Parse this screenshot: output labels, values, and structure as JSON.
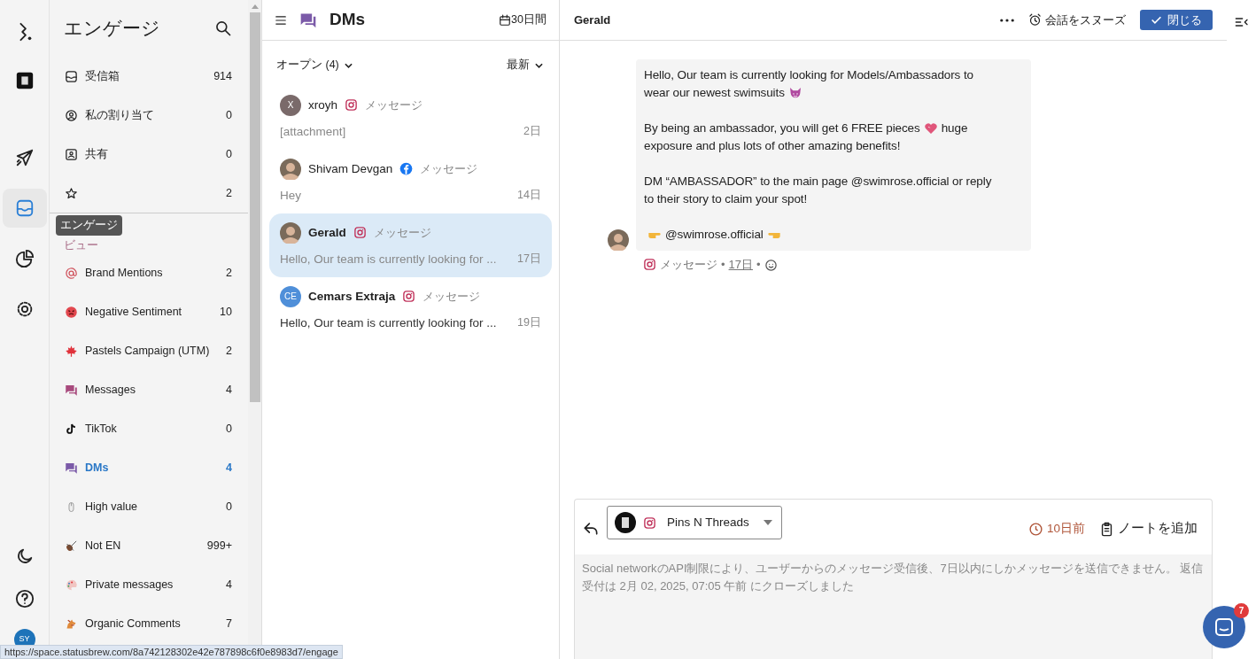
{
  "rail": {
    "items": [
      {
        "kind": "logo",
        "selected": false
      },
      {
        "kind": "brand",
        "selected": false
      },
      {
        "kind": "publish",
        "selected": false
      },
      {
        "kind": "engage",
        "selected": true
      },
      {
        "kind": "reports",
        "selected": false
      },
      {
        "kind": "settings",
        "selected": false
      }
    ],
    "bottom": [
      {
        "kind": "theme"
      },
      {
        "kind": "help"
      }
    ],
    "avatar": "SY",
    "tooltip": "エンゲージ"
  },
  "sidebar": {
    "title": "エンゲージ",
    "items": [
      {
        "kind": "inbox",
        "label": "受信箱",
        "count": "914",
        "selected": false
      },
      {
        "kind": "person",
        "label": "私の割り当て",
        "count": "0",
        "selected": false
      },
      {
        "kind": "shared",
        "label": "共有",
        "count": "0",
        "selected": false
      },
      {
        "kind": "star",
        "count": "2",
        "selected": false
      }
    ],
    "views_heading": "ビュー",
    "views": [
      {
        "kind": "at",
        "label": "Brand Mentions",
        "count": "2",
        "selected": false
      },
      {
        "kind": "angry",
        "label": "Negative Sentiment",
        "count": "10",
        "selected": false
      },
      {
        "kind": "leaf",
        "label": "Pastels Campaign (UTM)",
        "count": "2",
        "selected": false
      },
      {
        "kind": "chat",
        "label": "Messages",
        "count": "4",
        "selected": false
      },
      {
        "kind": "tiktok",
        "label": "TikTok",
        "count": "0",
        "selected": false
      },
      {
        "kind": "dm",
        "label": "DMs",
        "count": "4",
        "selected": true
      },
      {
        "kind": "mouse",
        "label": "High value",
        "count": "0",
        "selected": false
      },
      {
        "kind": "violin",
        "label": "Not EN",
        "count": "999+",
        "selected": false
      },
      {
        "kind": "palette",
        "label": "Private messages",
        "count": "4",
        "selected": false
      },
      {
        "kind": "horse",
        "label": "Organic Comments",
        "count": "7",
        "selected": false
      }
    ]
  },
  "list": {
    "title": "DMs",
    "range": "30日間",
    "filter": "オープン (4)",
    "sort": "最新",
    "conversations": [
      {
        "name": "xroyh",
        "avatar": {
          "kind": "initials",
          "text": "X"
        },
        "network": {
          "kind": "instagram"
        },
        "type": "メッセージ",
        "preview": "[attachment]",
        "age": "2日",
        "unread": false,
        "selected": false
      },
      {
        "name": "Shivam Devgan",
        "avatar": {
          "kind": "photo"
        },
        "network": {
          "kind": "facebook"
        },
        "type": "メッセージ",
        "preview": "Hey",
        "age": "14日",
        "unread": false,
        "selected": false
      },
      {
        "name": "Gerald",
        "avatar": {
          "kind": "photo"
        },
        "network": {
          "kind": "instagram"
        },
        "type": "メッセージ",
        "preview": "Hello, Our team is currently looking for ...",
        "age": "17日",
        "unread": true,
        "selected": true
      },
      {
        "name": "Cemars Extraja",
        "avatar": {
          "kind": "initials",
          "text": "CE"
        },
        "network": {
          "kind": "instagram"
        },
        "type": "メッセージ",
        "preview": "Hello, Our team is currently looking for ...",
        "age": "19日",
        "unread": true,
        "selected": false
      }
    ]
  },
  "conversation": {
    "contact": "Gerald",
    "snooze": "会話をスヌーズ",
    "close": "閉じる",
    "message": {
      "paragraphs": [
        [
          [
            {
              "kind": "text",
              "text": "Hello, Our team is currently looking for Models/Ambassadors to"
            }
          ],
          [
            {
              "kind": "text",
              "text": "wear our newest swimsuits"
            },
            {
              "kind": "devil"
            }
          ]
        ],
        [
          [
            {
              "kind": "text",
              "text": "By being an ambassador, you will get 6 FREE pieces"
            },
            {
              "kind": "heart"
            },
            {
              "kind": "text",
              "text": "huge"
            }
          ],
          [
            {
              "kind": "text",
              "text": "exposure and plus lots of other amazing benefits!"
            }
          ]
        ],
        [
          [
            {
              "kind": "text",
              "text": "DM “AMBASSADOR” to the main page @swimrose.official or reply"
            }
          ],
          [
            {
              "kind": "text",
              "text": "to their story to claim your spot!"
            }
          ]
        ],
        [
          [
            {
              "kind": "point-right"
            },
            {
              "kind": "text",
              "text": "@swimrose.official"
            },
            {
              "kind": "point-left"
            }
          ]
        ]
      ],
      "network": {
        "kind": "instagram"
      },
      "type": "メッセージ",
      "separator": "•",
      "age": "17日"
    }
  },
  "composer": {
    "account": "Pins N Threads",
    "network": {
      "kind": "instagram"
    },
    "reply_window": "10日前",
    "add_note": "ノートを追加",
    "notice": "Social networkのAPI制限により、ユーザーからのメッセージ受信後、7日以内にしかメッセージを送信できません。 返信受付は 2月 02, 2025, 07:05 午前 にクローズしました"
  },
  "launcher": {
    "badge": "7"
  },
  "status_url": "https://space.statusbrew.com/8a742128302e42e787898c6f0e8983d7/engage"
}
